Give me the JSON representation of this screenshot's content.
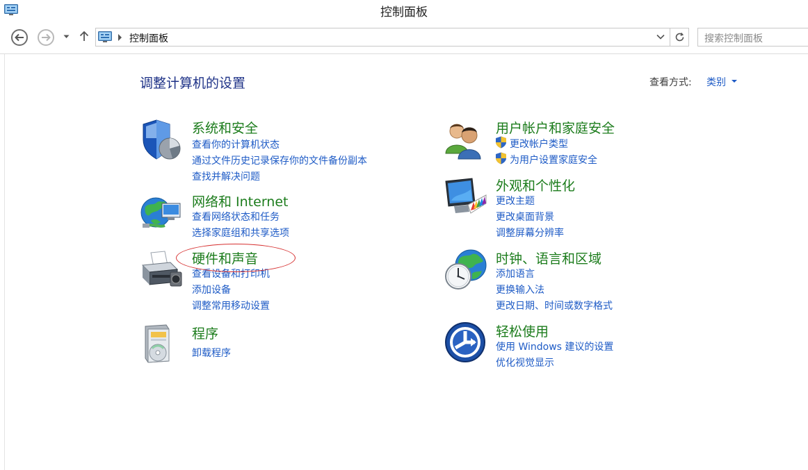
{
  "window": {
    "title": "控制面板"
  },
  "address_bar": {
    "breadcrumb": "控制面板",
    "search_placeholder": "搜索控制面板"
  },
  "content": {
    "heading": "调整计算机的设置",
    "view_by_label": "查看方式:",
    "view_by_value": "类别"
  },
  "categories": [
    {
      "title": "系统和安全",
      "icon": "shield-icon",
      "links": [
        "查看你的计算机状态",
        "通过文件历史记录保存你的文件备份副本",
        "查找并解决问题"
      ]
    },
    {
      "title": "网络和 Internet",
      "icon": "network-globe-icon",
      "links": [
        "查看网络状态和任务",
        "选择家庭组和共享选项"
      ]
    },
    {
      "title": "硬件和声音",
      "icon": "printer-icon",
      "links": [
        "查看设备和打印机",
        "添加设备",
        "调整常用移动设置"
      ]
    },
    {
      "title": "程序",
      "icon": "programs-disc-icon",
      "links": [
        "卸载程序"
      ]
    },
    {
      "title": "用户帐户和家庭安全",
      "icon": "users-icon",
      "links": [
        "更改帐户类型",
        "为用户设置家庭安全"
      ]
    },
    {
      "title": "外观和个性化",
      "icon": "monitor-palette-icon",
      "links": [
        "更改主题",
        "更改桌面背景",
        "调整屏幕分辨率"
      ]
    },
    {
      "title": "时钟、语言和区域",
      "icon": "clock-globe-icon",
      "links": [
        "添加语言",
        "更换输入法",
        "更改日期、时间或数字格式"
      ]
    },
    {
      "title": "轻松使用",
      "icon": "ease-of-access-icon",
      "links": [
        "使用 Windows 建议的设置",
        "优化视觉显示"
      ]
    }
  ]
}
